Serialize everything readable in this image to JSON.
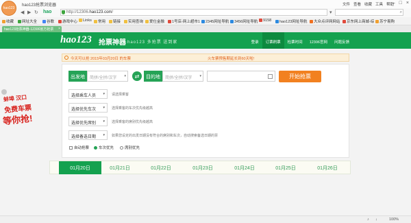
{
  "window": {
    "title": "hao123抢票浏览器",
    "logo_text": "hao123",
    "title_menu": [
      "文件",
      "查看",
      "收藏",
      "工具",
      "帮助"
    ]
  },
  "address_bar": {
    "hao_logo": "hao",
    "url_prefix": "http://12306.",
    "url_domain": "hao123.com",
    "url_suffix": "/",
    "search_placeholder": ""
  },
  "bookmarks": [
    {
      "label": "收藏",
      "color": "#f0a030"
    },
    {
      "label": "网址大全",
      "color": "#3fa53f"
    },
    {
      "label": "谷歌",
      "color": "#4285f4"
    },
    {
      "label": "游戏中心",
      "color": "#e04a3c"
    },
    {
      "label": "Links",
      "color": "#f0c040"
    },
    {
      "label": "常用",
      "color": "#f0c040"
    },
    {
      "label": "链接",
      "color": "#f0c040"
    },
    {
      "label": "实用查询",
      "color": "#f0c040"
    },
    {
      "label": "爱仕金融",
      "color": "#f0c040"
    },
    {
      "label": "1号店-网上超市1",
      "color": "#e04a3c"
    },
    {
      "label": "2345网址导航",
      "color": "#2c8ae0"
    },
    {
      "label": "3456网址导航",
      "color": "#2c8ae0"
    },
    {
      "label": "9158",
      "color": "#e04a3c"
    },
    {
      "label": "hao123网址导航",
      "color": "#2c8ae0"
    },
    {
      "label": "大众点评网网站",
      "color": "#f07020"
    },
    {
      "label": "京东网上商城-综",
      "color": "#e04a3c"
    },
    {
      "label": "苏宁易购",
      "color": "#f0a030"
    }
  ],
  "tab": {
    "label": "hao123抢票神器-12306官方抢票"
  },
  "header": {
    "brand": "hao123",
    "brand_cn": "抢票神器",
    "slogan": "hao123 多抢票 送到家",
    "nav": [
      "登录",
      "订票刷票",
      "检票时间",
      "12306官网",
      "问题反馈"
    ]
  },
  "notice": {
    "text_left": "今天可以抢 2015年03月20日 的车票",
    "text_right": "火车票预售期延长到60天啦!"
  },
  "search_form": {
    "from_label": "出发地",
    "from_placeholder": "简拼/全拼/汉字",
    "to_label": "目的地",
    "to_placeholder": "简拼/全拼/汉字",
    "swap": "⇄",
    "date_value": "",
    "start_button": "开始抢票"
  },
  "options": [
    {
      "select": "选择乘车人员",
      "hint": "请选择乘客"
    },
    {
      "select": "选择优先车次",
      "hint": "选择乘客的车次优先级越高"
    },
    {
      "select": "选择优先席别",
      "hint": "选择乘客的席别优先级越高"
    },
    {
      "select": "选择备选日期",
      "hint": "如果您设定的出发日期没有符合的席别和车次，自动搜索备选日期的票"
    }
  ],
  "checkboxes": {
    "auto": "自动抢票",
    "train_first": "车次优先",
    "seat_first": "席别优先"
  },
  "left_ad": {
    "line1": "蚌埠 汉口",
    "line2": "免费车票",
    "line3": "等你抢!"
  },
  "date_tabs": [
    "01月20日",
    "01月21日",
    "01月22日",
    "01月23日",
    "01月24日",
    "01月25日",
    "01月26日"
  ],
  "status_bar": {
    "left": "",
    "zoom": "100%"
  }
}
